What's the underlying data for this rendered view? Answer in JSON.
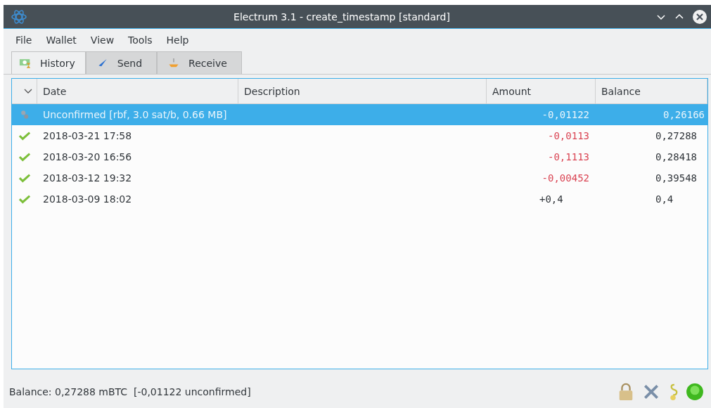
{
  "window": {
    "title": "Electrum 3.1 - create_timestamp [standard]"
  },
  "menu": [
    "File",
    "Wallet",
    "View",
    "Tools",
    "Help"
  ],
  "tabs": [
    {
      "label": "History",
      "selected": true,
      "kind": "history"
    },
    {
      "label": "Send",
      "selected": false,
      "kind": "send"
    },
    {
      "label": "Receive",
      "selected": false,
      "kind": "receive"
    }
  ],
  "table": {
    "columns": [
      "Date",
      "Description",
      "Amount",
      "Balance"
    ],
    "rows": [
      {
        "kind": "unconfirmed",
        "date": "Unconfirmed [rbf, 3.0 sat/b, 0.66 MB]",
        "amount": "-0,01122",
        "balance": "0,26166",
        "negative": true,
        "selected": true
      },
      {
        "kind": "confirmed",
        "date": "2018-03-21 17:58",
        "amount": "-0,0113",
        "balance": "0,27288",
        "negative": true,
        "selected": false
      },
      {
        "kind": "confirmed",
        "date": "2018-03-20 16:56",
        "amount": "-0,1113",
        "balance": "0,28418",
        "negative": true,
        "selected": false
      },
      {
        "kind": "confirmed",
        "date": "2018-03-12 19:32",
        "amount": "-0,00452",
        "balance": "0,39548",
        "negative": true,
        "selected": false
      },
      {
        "kind": "confirmed",
        "date": "2018-03-09 18:02",
        "amount": "+0,4",
        "balance": "0,4",
        "negative": false,
        "selected": false
      }
    ]
  },
  "status_bar": {
    "text": "Balance: 0,27288 mBTC  [-0,01122 unconfirmed]"
  }
}
